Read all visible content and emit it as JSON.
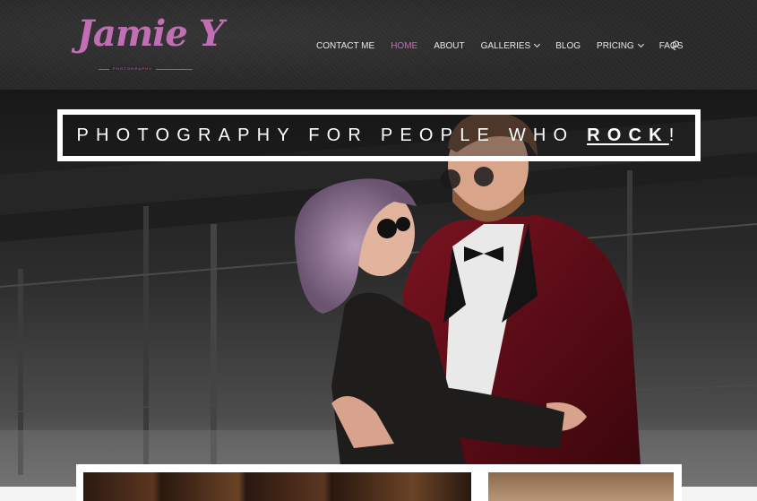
{
  "brand": {
    "logo_script": "Jamie Y",
    "logo_sub": "PHOTOGRAPHY",
    "accent_color": "#c06fb4"
  },
  "nav": {
    "items": [
      {
        "label": "CONTACT ME",
        "active": false,
        "dropdown": false
      },
      {
        "label": "HOME",
        "active": true,
        "dropdown": false
      },
      {
        "label": "ABOUT",
        "active": false,
        "dropdown": false
      },
      {
        "label": "GALLERIES",
        "active": false,
        "dropdown": true
      },
      {
        "label": "BLOG",
        "active": false,
        "dropdown": false
      },
      {
        "label": "PRICING",
        "active": false,
        "dropdown": true
      },
      {
        "label": "FAQS",
        "active": false,
        "dropdown": false
      }
    ],
    "search_icon": "search-icon"
  },
  "hero": {
    "tagline_pre": "PHOTOGRAPHY FOR PEOPLE WHO ",
    "tagline_emphasis": "ROCK",
    "tagline_post": "!"
  }
}
